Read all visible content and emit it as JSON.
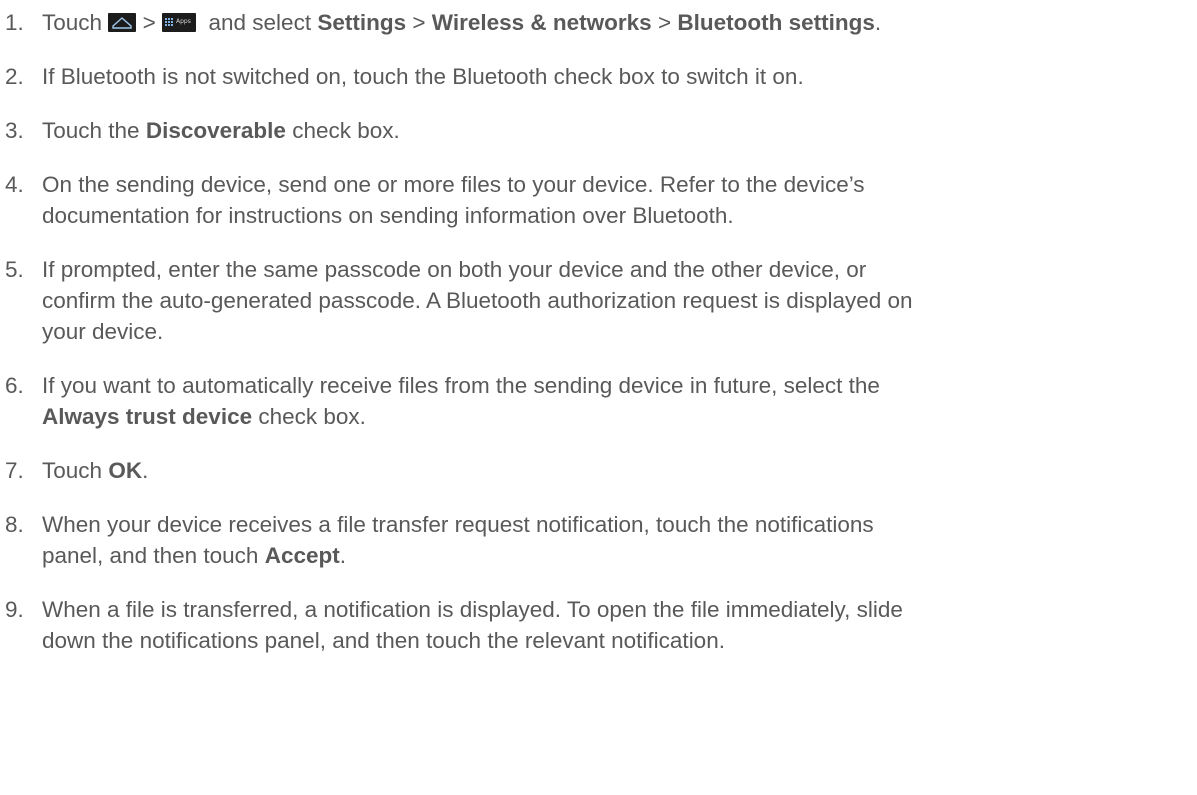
{
  "steps": [
    {
      "number": "1.",
      "intro": "Touch",
      "sep1": ">",
      "apps_icon_label": "Apps",
      "mid": "and select",
      "settings": "Settings",
      "sep2": ">",
      "wireless": "Wireless & networks",
      "sep3": ">",
      "bt_settings": "Bluetooth settings",
      "end": ".",
      "icons": [
        "home-icon",
        "apps-icon"
      ]
    },
    {
      "number": "2.",
      "text": "If Bluetooth is not switched on, touch the Bluetooth check box to switch it on."
    },
    {
      "number": "3.",
      "pre": "Touch the",
      "bold": "Discoverable",
      "post": "check box."
    },
    {
      "number": "4.",
      "line1": "On the sending device, send one or more files to your device. Refer to the device’s",
      "line2": "documentation for instructions on sending information over Bluetooth."
    },
    {
      "number": "5.",
      "line1": "If prompted, enter the same passcode on both your device and the other device, or",
      "line2": "confirm the auto-generated passcode. A Bluetooth authorization request is displayed on",
      "line3": "your device."
    },
    {
      "number": "6.",
      "line1": "If you want to automatically receive files from the sending device in future, select the",
      "bold": "Always trust device",
      "post": "check box."
    },
    {
      "number": "7.",
      "pre": "Touch",
      "bold": "OK",
      "post": "."
    },
    {
      "number": "8.",
      "line1": "When your device receives a file transfer request notification, touch the notifications",
      "pre": "panel, and then touch",
      "bold": "Accept",
      "post": "."
    },
    {
      "number": "9.",
      "line1": "When a file is transferred, a notification is displayed. To open the file immediately, slide",
      "line2": "down the notifications panel, and then touch the relevant notification."
    }
  ],
  "colors": {
    "text": "#595959",
    "icon_bg": "#1c1c1c",
    "apps_grid": "#7fb3e6"
  }
}
